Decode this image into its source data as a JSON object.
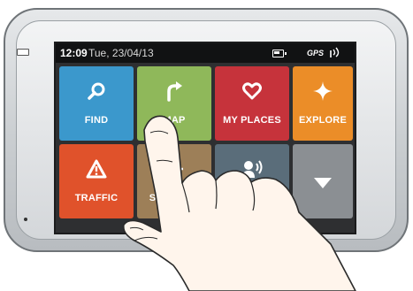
{
  "status": {
    "time": "12:09",
    "date": "Tue, 23/04/13",
    "battery_icon": "battery-icon",
    "gps_label": "GPS",
    "signal_icon": "gps-signal-icon"
  },
  "tiles": [
    {
      "label": "FIND",
      "icon": "search-icon",
      "color": "#3b98cc"
    },
    {
      "label": "MAP",
      "icon": "map-arrow-icon",
      "color": "#8fb85a"
    },
    {
      "label": "MY PLACES",
      "icon": "heart-icon",
      "color": "#c6333b"
    },
    {
      "label": "EXPLORE",
      "icon": "sparkle-icon",
      "color": "#eb8d28"
    },
    {
      "label": "TRAFFIC",
      "icon": "warning-icon",
      "color": "#e0522b"
    },
    {
      "label": "SETTINGS",
      "icon": "gear-icon",
      "color": "#9d7f58"
    },
    {
      "label": "",
      "icon": "voice-icon",
      "color": "#5a6d7a"
    },
    {
      "label": "",
      "icon": "chevron-down-icon",
      "color": "#8b8f93"
    }
  ]
}
